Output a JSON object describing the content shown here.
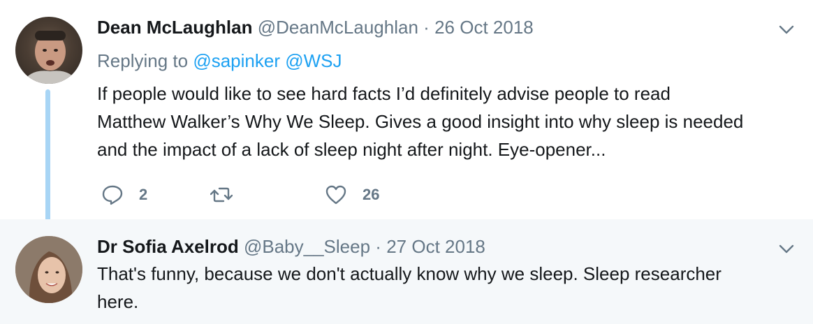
{
  "tweets": [
    {
      "name": "Dean McLaughlan",
      "handle": "@DeanMcLaughlan",
      "separator": "·",
      "date": "26 Oct 2018",
      "replying_label": "Replying to",
      "mentions": [
        "@sapinker",
        "@WSJ"
      ],
      "text_lines": [
        "If people would like to see hard facts I’d definitely advise people to read",
        "Matthew Walker’s Why We Sleep. Gives a good insight into why sleep is needed",
        "and the impact of a lack of sleep night after night. Eye-opener..."
      ],
      "reply_count": "2",
      "like_count": "26"
    },
    {
      "name": "Dr Sofia Axelrod",
      "handle": "@Baby__Sleep",
      "separator": "·",
      "date": "27 Oct 2018",
      "text_lines": [
        "That's funny, because we don't actually know why we sleep. Sleep researcher",
        "here."
      ]
    }
  ],
  "colors": {
    "link": "#1da1f2",
    "muted": "#657786",
    "thread_line": "#a8d5f5",
    "highlight_bg": "#f5f8fa"
  },
  "icons": [
    "chevron-down-icon",
    "reply-icon",
    "retweet-icon",
    "like-icon"
  ]
}
